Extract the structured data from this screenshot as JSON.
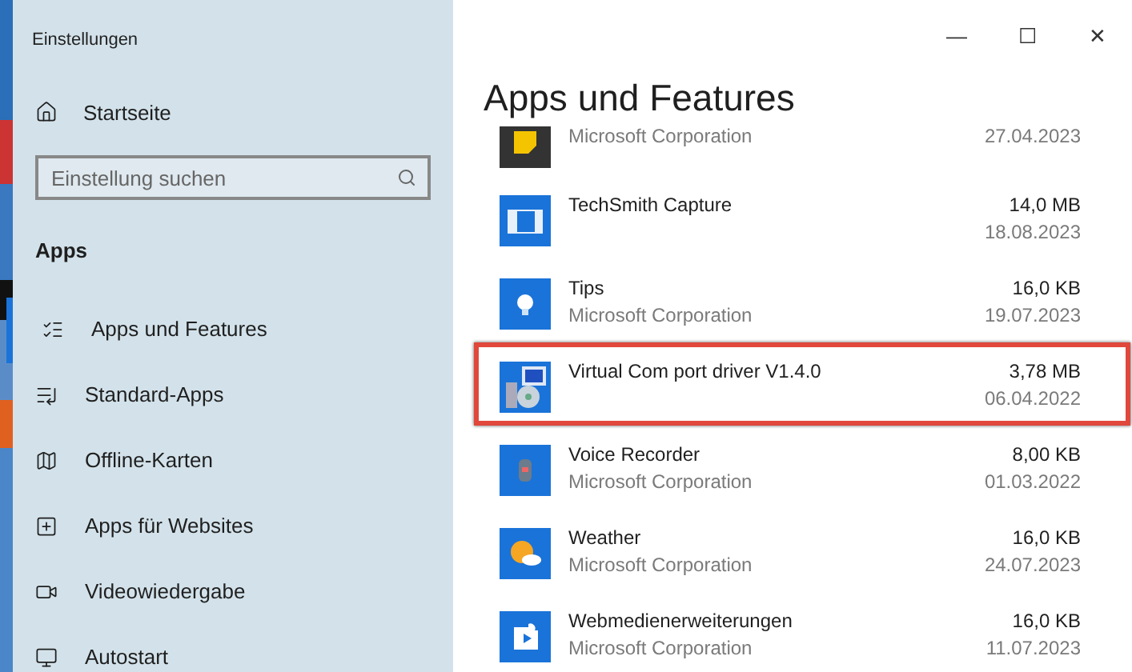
{
  "window": {
    "title": "Einstellungen",
    "controls": [
      "—",
      "☐",
      "✕"
    ]
  },
  "sidebar": {
    "home": "Startseite",
    "search": {
      "placeholder": "Einstellung suchen"
    },
    "section": "Apps",
    "items": [
      {
        "label": "Apps und Features",
        "kind": "list",
        "selected": true
      },
      {
        "label": "Standard-Apps",
        "kind": "defaults",
        "selected": false
      },
      {
        "label": "Offline-Karten",
        "kind": "map",
        "selected": false
      },
      {
        "label": "Apps für Websites",
        "kind": "web",
        "selected": false
      },
      {
        "label": "Videowiedergabe",
        "kind": "video",
        "selected": false
      },
      {
        "label": "Autostart",
        "kind": "startup",
        "selected": false
      }
    ]
  },
  "page": {
    "title": "Apps und Features",
    "apps": [
      {
        "kind": "sticky",
        "publisher": "Microsoft Corporation",
        "date": "27.04.2023",
        "highlighted": false
      },
      {
        "kind": "capture",
        "name": "TechSmith Capture",
        "size": "14,0 MB",
        "date": "18.08.2023",
        "highlighted": false
      },
      {
        "kind": "tips",
        "name": "Tips",
        "publisher": "Microsoft Corporation",
        "size": "16,0 KB",
        "date": "19.07.2023",
        "highlighted": false
      },
      {
        "kind": "driver",
        "name": "Virtual Com port driver V1.4.0",
        "size": "3,78 MB",
        "date": "06.04.2022",
        "highlighted": true
      },
      {
        "kind": "recorder",
        "name": "Voice Recorder",
        "publisher": "Microsoft Corporation",
        "size": "8,00 KB",
        "date": "01.03.2022",
        "highlighted": false
      },
      {
        "kind": "weather",
        "name": "Weather",
        "publisher": "Microsoft Corporation",
        "size": "16,0 KB",
        "date": "24.07.2023",
        "highlighted": false
      },
      {
        "kind": "extension",
        "name": "Webmedienerweiterungen",
        "publisher": "Microsoft Corporation",
        "size": "16,0 KB",
        "date": "11.07.2023",
        "highlighted": false
      }
    ]
  }
}
